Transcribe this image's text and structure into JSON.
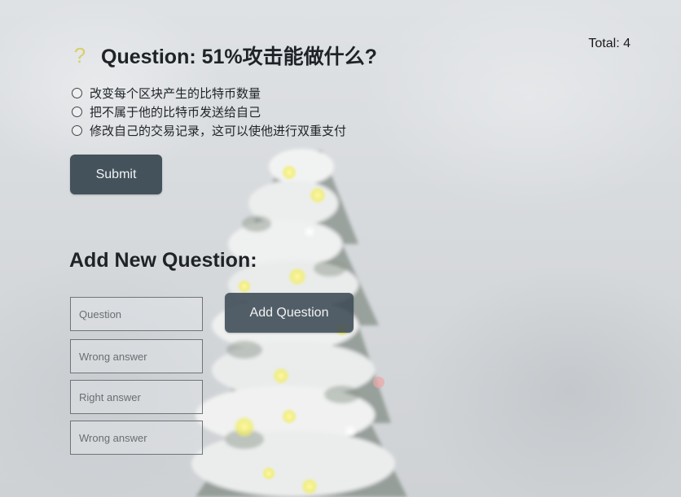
{
  "header": {
    "total": "Total: 4"
  },
  "question": {
    "icon": "question-mark-icon",
    "icon_color": "#d8cf6a",
    "title": "Question: 51%攻击能做什么?",
    "options": [
      {
        "label": "改变每个区块产生的比特币数量"
      },
      {
        "label": "把不属于他的比特币发送给自己"
      },
      {
        "label": "修改自己的交易记录，这可以使他进行双重支付"
      }
    ],
    "submit_label": "Submit"
  },
  "add_question": {
    "title": "Add New Question:",
    "fields": [
      {
        "placeholder": "Question",
        "value": ""
      },
      {
        "placeholder": "Wrong answer",
        "value": ""
      },
      {
        "placeholder": "Right answer",
        "value": ""
      },
      {
        "placeholder": "Wrong answer",
        "value": ""
      }
    ],
    "add_label": "Add Question"
  },
  "colors": {
    "button_bg": "#44525c",
    "button_text": "#f1f3f4",
    "background": "#d9dcdf"
  }
}
